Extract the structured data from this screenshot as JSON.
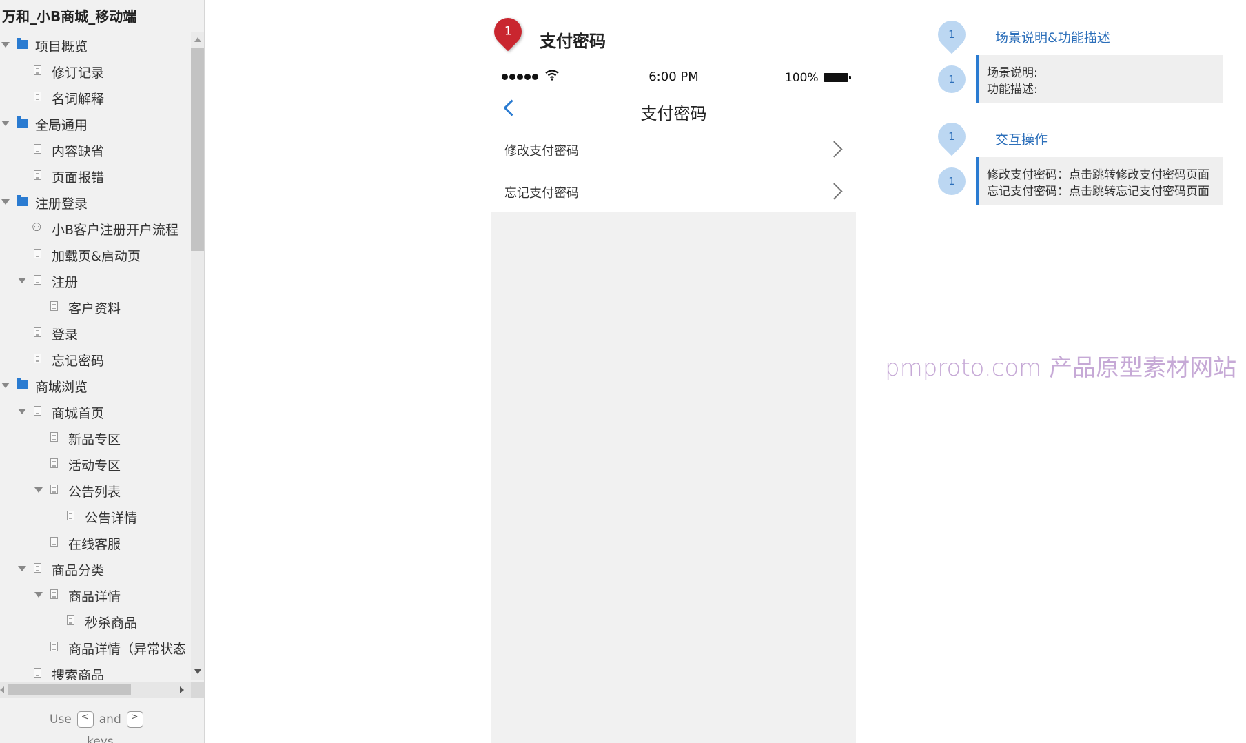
{
  "sidebar": {
    "title": "万和_小B商城_移动端",
    "tree": [
      {
        "label": "项目概览",
        "level": 0,
        "type": "folder",
        "expanded": true
      },
      {
        "label": "修订记录",
        "level": 1,
        "type": "page"
      },
      {
        "label": "名词解释",
        "level": 1,
        "type": "page"
      },
      {
        "label": "全局通用",
        "level": 0,
        "type": "folder",
        "expanded": true
      },
      {
        "label": "内容缺省",
        "level": 1,
        "type": "page"
      },
      {
        "label": "页面报错",
        "level": 1,
        "type": "page"
      },
      {
        "label": "注册登录",
        "level": 0,
        "type": "folder",
        "expanded": true
      },
      {
        "label": "小B客户注册开户流程",
        "level": 1,
        "type": "flow"
      },
      {
        "label": "加载页&启动页",
        "level": 1,
        "type": "page"
      },
      {
        "label": "注册",
        "level": 1,
        "type": "page",
        "expanded": true
      },
      {
        "label": "客户资料",
        "level": 2,
        "type": "page"
      },
      {
        "label": "登录",
        "level": 1,
        "type": "page"
      },
      {
        "label": "忘记密码",
        "level": 1,
        "type": "page"
      },
      {
        "label": "商城浏览",
        "level": 0,
        "type": "folder",
        "expanded": true
      },
      {
        "label": "商城首页",
        "level": 1,
        "type": "page",
        "expanded": true
      },
      {
        "label": "新品专区",
        "level": 2,
        "type": "page"
      },
      {
        "label": "活动专区",
        "level": 2,
        "type": "page"
      },
      {
        "label": "公告列表",
        "level": 2,
        "type": "page",
        "expanded": true
      },
      {
        "label": "公告详情",
        "level": 3,
        "type": "page"
      },
      {
        "label": "在线客服",
        "level": 2,
        "type": "page"
      },
      {
        "label": "商品分类",
        "level": 1,
        "type": "page",
        "expanded": true
      },
      {
        "label": "商品详情",
        "level": 2,
        "type": "page",
        "expanded": true
      },
      {
        "label": "秒杀商品",
        "level": 3,
        "type": "page"
      },
      {
        "label": "商品详情（异常状态",
        "level": 2,
        "type": "page"
      },
      {
        "label": "搜索商品",
        "level": 1,
        "type": "page"
      }
    ],
    "hint": {
      "use": "Use",
      "key_left": "<",
      "and": "and",
      "key_right": ">",
      "tail": "keys"
    }
  },
  "page": {
    "marker_number": "1",
    "heading": "支付密码"
  },
  "phone": {
    "status": {
      "time": "6:00 PM",
      "battery": "100%"
    },
    "nav_title": "支付密码",
    "menu": [
      {
        "label": "修改支付密码"
      },
      {
        "label": "忘记支付密码"
      }
    ]
  },
  "annotations": {
    "marker_number": "1",
    "sections": [
      {
        "heading": "场景说明&功能描述",
        "lines": [
          "场景说明:",
          "功能描述:"
        ]
      },
      {
        "heading": "交互操作",
        "lines": [
          "修改支付密码：点击跳转修改支付密码页面",
          "忘记支付密码：点击跳转忘记支付密码页面"
        ]
      }
    ]
  },
  "watermark": "pmproto.com 产品原型素材网站",
  "colors": {
    "accent": "#2a7bd1",
    "marker_red": "#c9262f",
    "marker_blue": "#bcd7f2",
    "watermark": "#c6a9d6"
  }
}
